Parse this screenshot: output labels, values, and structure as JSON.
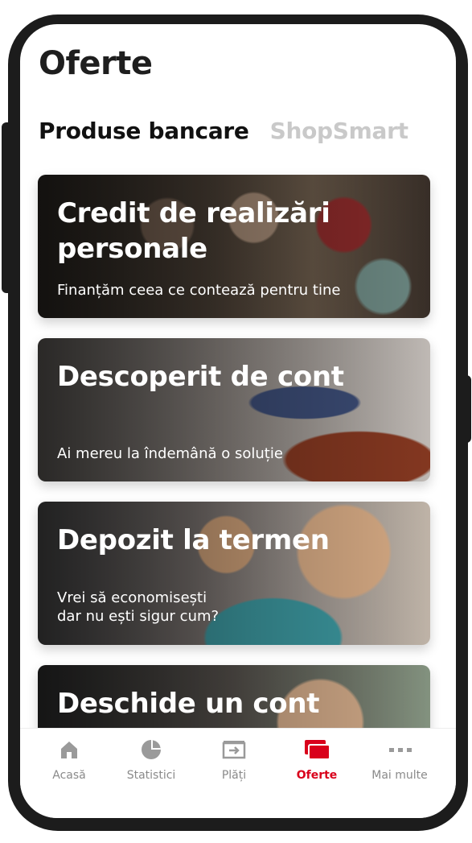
{
  "page": {
    "title": "Oferte"
  },
  "tabs": [
    {
      "label": "Produse bancare",
      "active": true
    },
    {
      "label": "ShopSmart",
      "active": false
    }
  ],
  "cards": [
    {
      "title": "Credit de realizări personale",
      "subtitle": "Finanțăm ceea ce contează pentru tine"
    },
    {
      "title": "Descoperit de cont",
      "subtitle": "Ai mereu la îndemână o soluție"
    },
    {
      "title": "Depozit la termen",
      "subtitle_line1": "Vrei să economisești",
      "subtitle_line2": "dar nu ești sigur cum?"
    },
    {
      "title": "Deschide un cont"
    }
  ],
  "tabbar": {
    "items": [
      {
        "label": "Acasă",
        "icon": "home-icon",
        "active": false
      },
      {
        "label": "Statistici",
        "icon": "pie-chart-icon",
        "active": false
      },
      {
        "label": "Plăți",
        "icon": "transfer-icon",
        "active": false
      },
      {
        "label": "Oferte",
        "icon": "cards-icon",
        "active": true
      },
      {
        "label": "Mai multe",
        "icon": "more-icon",
        "active": false
      }
    ]
  },
  "colors": {
    "accent": "#d9001b",
    "inactive_tab": "#c9c9c9",
    "tabbar_inactive": "#8a8a8a",
    "icon_gray": "#9a9a9a"
  }
}
